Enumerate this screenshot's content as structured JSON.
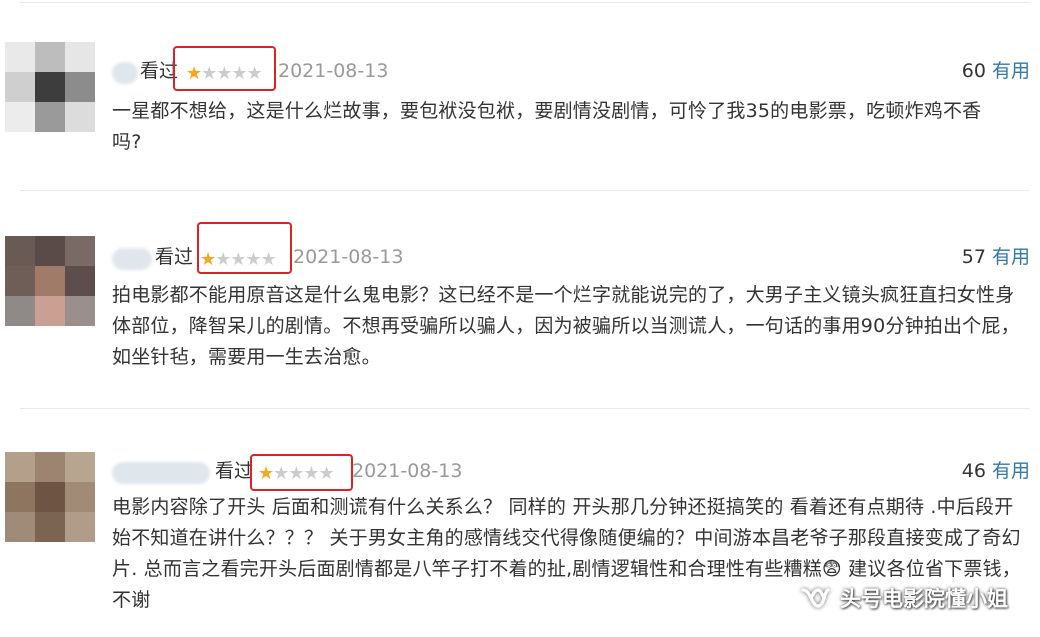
{
  "colors": {
    "accent_link": "#3377aa",
    "star_filled": "#f5a623",
    "star_empty": "#cccccc",
    "highlight_box": "#d9232a",
    "date_gray": "#999999"
  },
  "reviews": [
    {
      "watched_label": "看过",
      "stars_filled": 1,
      "stars_total": 5,
      "date": "2021-08-13",
      "votes": "60",
      "useful_label": "有用",
      "text": "一星都不想给，这是什么烂故事，要包袱没包袱，要剧情没剧情，可怜了我35的电影票，吃顿炸鸡不香吗?"
    },
    {
      "watched_label": "看过",
      "stars_filled": 1,
      "stars_total": 5,
      "date": "2021-08-13",
      "votes": "57",
      "useful_label": "有用",
      "text": "拍电影都不能用原音这是什么鬼电影？这已经不是一个烂字就能说完的了，大男子主义镜头疯狂直扫女性身体部位，降智呆儿的剧情。不想再受骗所以骗人，因为被骗所以当测谎人，一句话的事用90分钟拍出个屁，如坐针毡，需要用一生去治愈。"
    },
    {
      "watched_label": "看过",
      "stars_filled": 1,
      "stars_total": 5,
      "date": "2021-08-13",
      "votes": "46",
      "useful_label": "有用",
      "text": "电影内容除了开头 后面和测谎有什么关系么？ 同样的 开头那几分钟还挺搞笑的 看着还有点期待 .中后段开始不知道在讲什么？？？ 关于男女主角的感情线交代得像随便编的？中间游本昌老爷子那段直接变成了奇幻片. 总而言之看完开头后面剧情都是八竿子打不着的扯,剧情逻辑性和合理性有些糟糕😨 建议各位省下票钱，不谢"
    }
  ],
  "watermark": {
    "icon": "wechat-channel-icon",
    "text": "头号电影院懂小姐"
  }
}
